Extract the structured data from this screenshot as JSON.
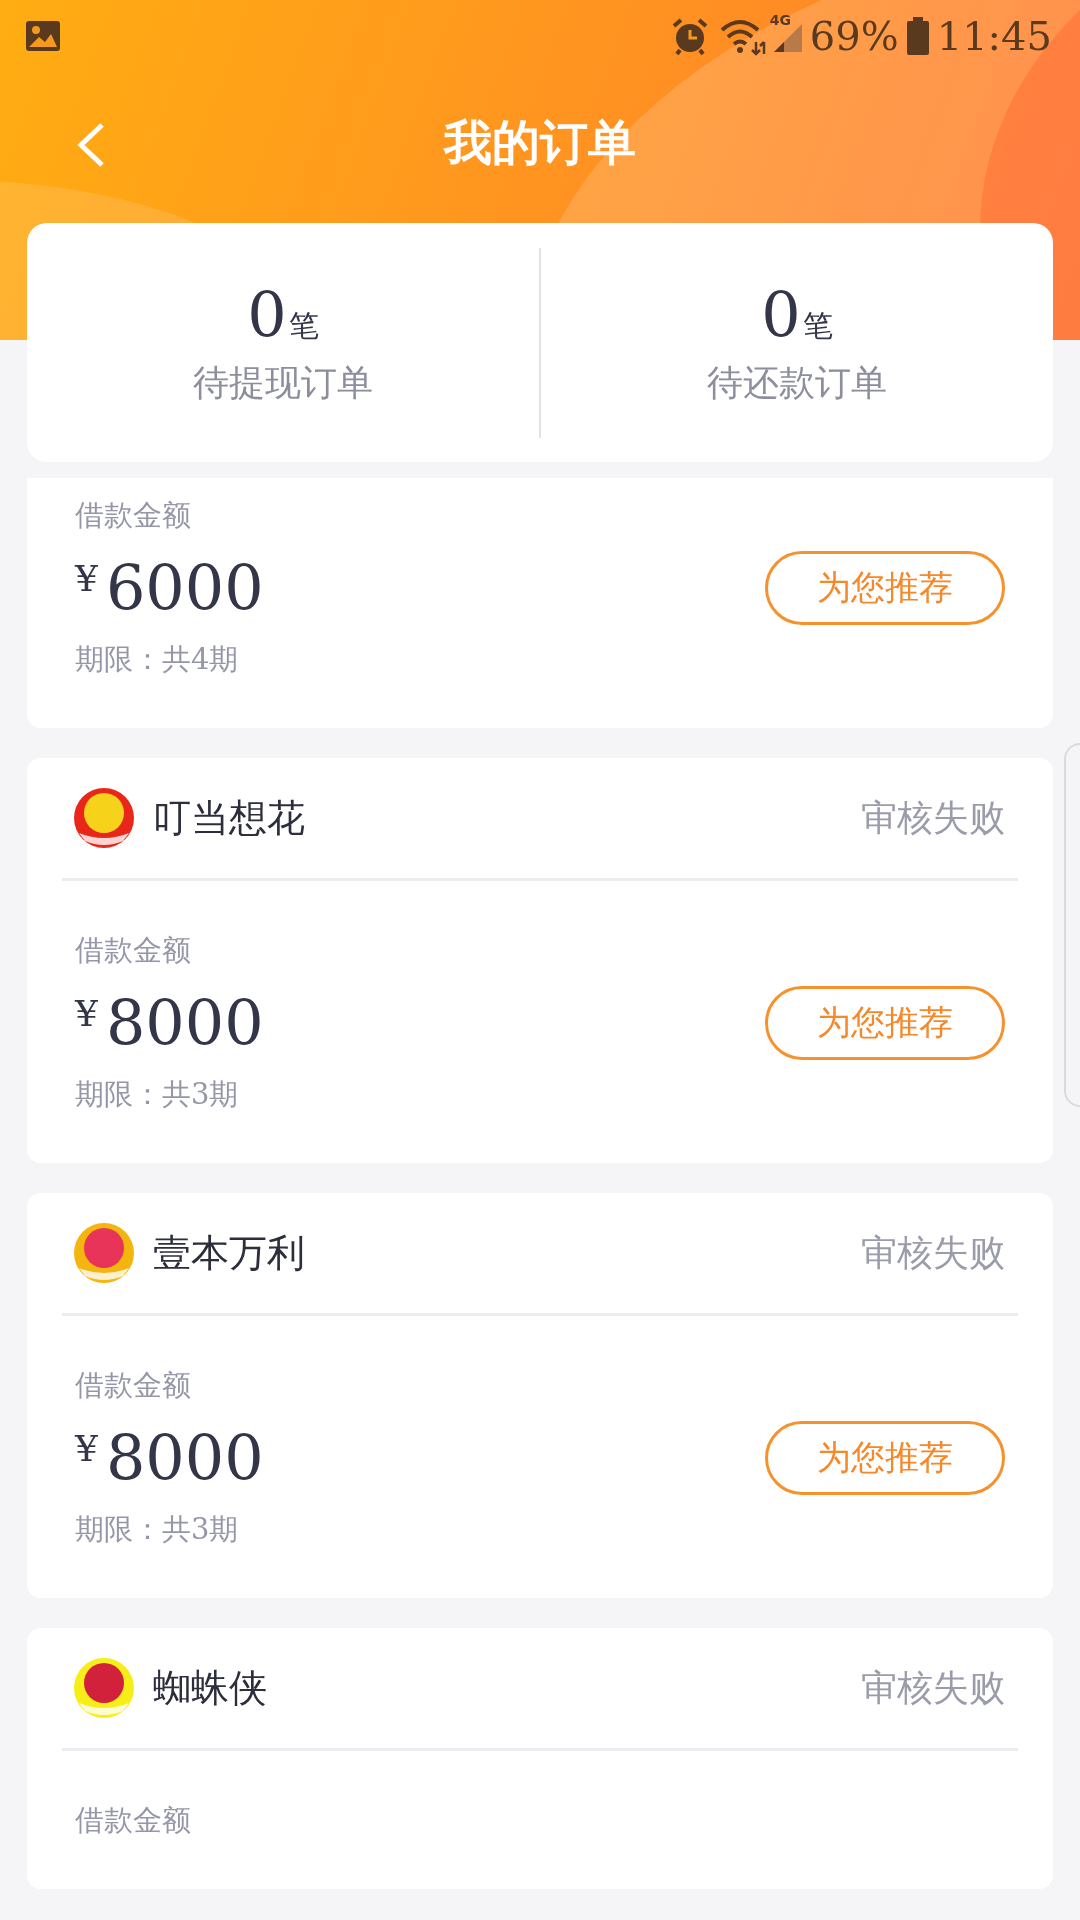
{
  "status_bar": {
    "network": "4G",
    "battery": "69%",
    "time": "11:45"
  },
  "header": {
    "title": "我的订单"
  },
  "summary": [
    {
      "count": "0",
      "unit": "笔",
      "label": "待提现订单"
    },
    {
      "count": "0",
      "unit": "笔",
      "label": "待还款订单"
    }
  ],
  "orders": [
    {
      "amount_label": "借款金额",
      "currency": "¥",
      "amount": "6000",
      "term": "期限：共4期",
      "button": "为您推荐"
    },
    {
      "name": "叮当想花",
      "status": "审核失败",
      "amount_label": "借款金额",
      "currency": "¥",
      "amount": "8000",
      "term": "期限：共3期",
      "button": "为您推荐"
    },
    {
      "name": "壹本万利",
      "status": "审核失败",
      "amount_label": "借款金额",
      "currency": "¥",
      "amount": "8000",
      "term": "期限：共3期",
      "button": "为您推荐"
    },
    {
      "name": "蜘蛛侠",
      "status": "审核失败",
      "amount_label": "借款金额"
    }
  ]
}
